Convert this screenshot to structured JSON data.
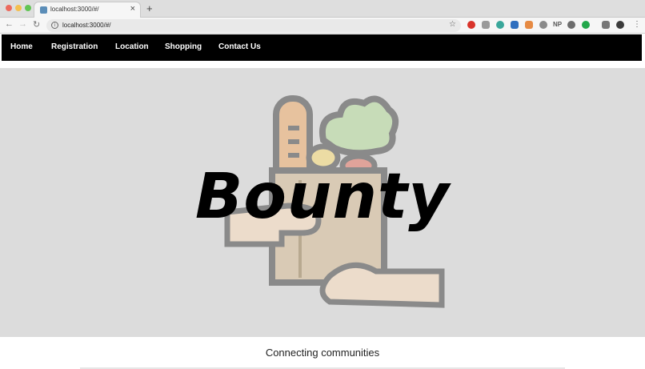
{
  "browser": {
    "tab_title": "localhost:3000/#/",
    "tab_close": "×",
    "new_tab": "+",
    "url": "localhost:3000/#/",
    "extensions": [
      "NP"
    ]
  },
  "nav": {
    "items": [
      "Home",
      "Registration",
      "Location",
      "Shopping",
      "Contact Us"
    ]
  },
  "hero": {
    "logo": "Bounty"
  },
  "tagline": "Connecting communities",
  "colors": {
    "nav_bg": "#000000",
    "hero_bg": "#dcdcdc"
  }
}
